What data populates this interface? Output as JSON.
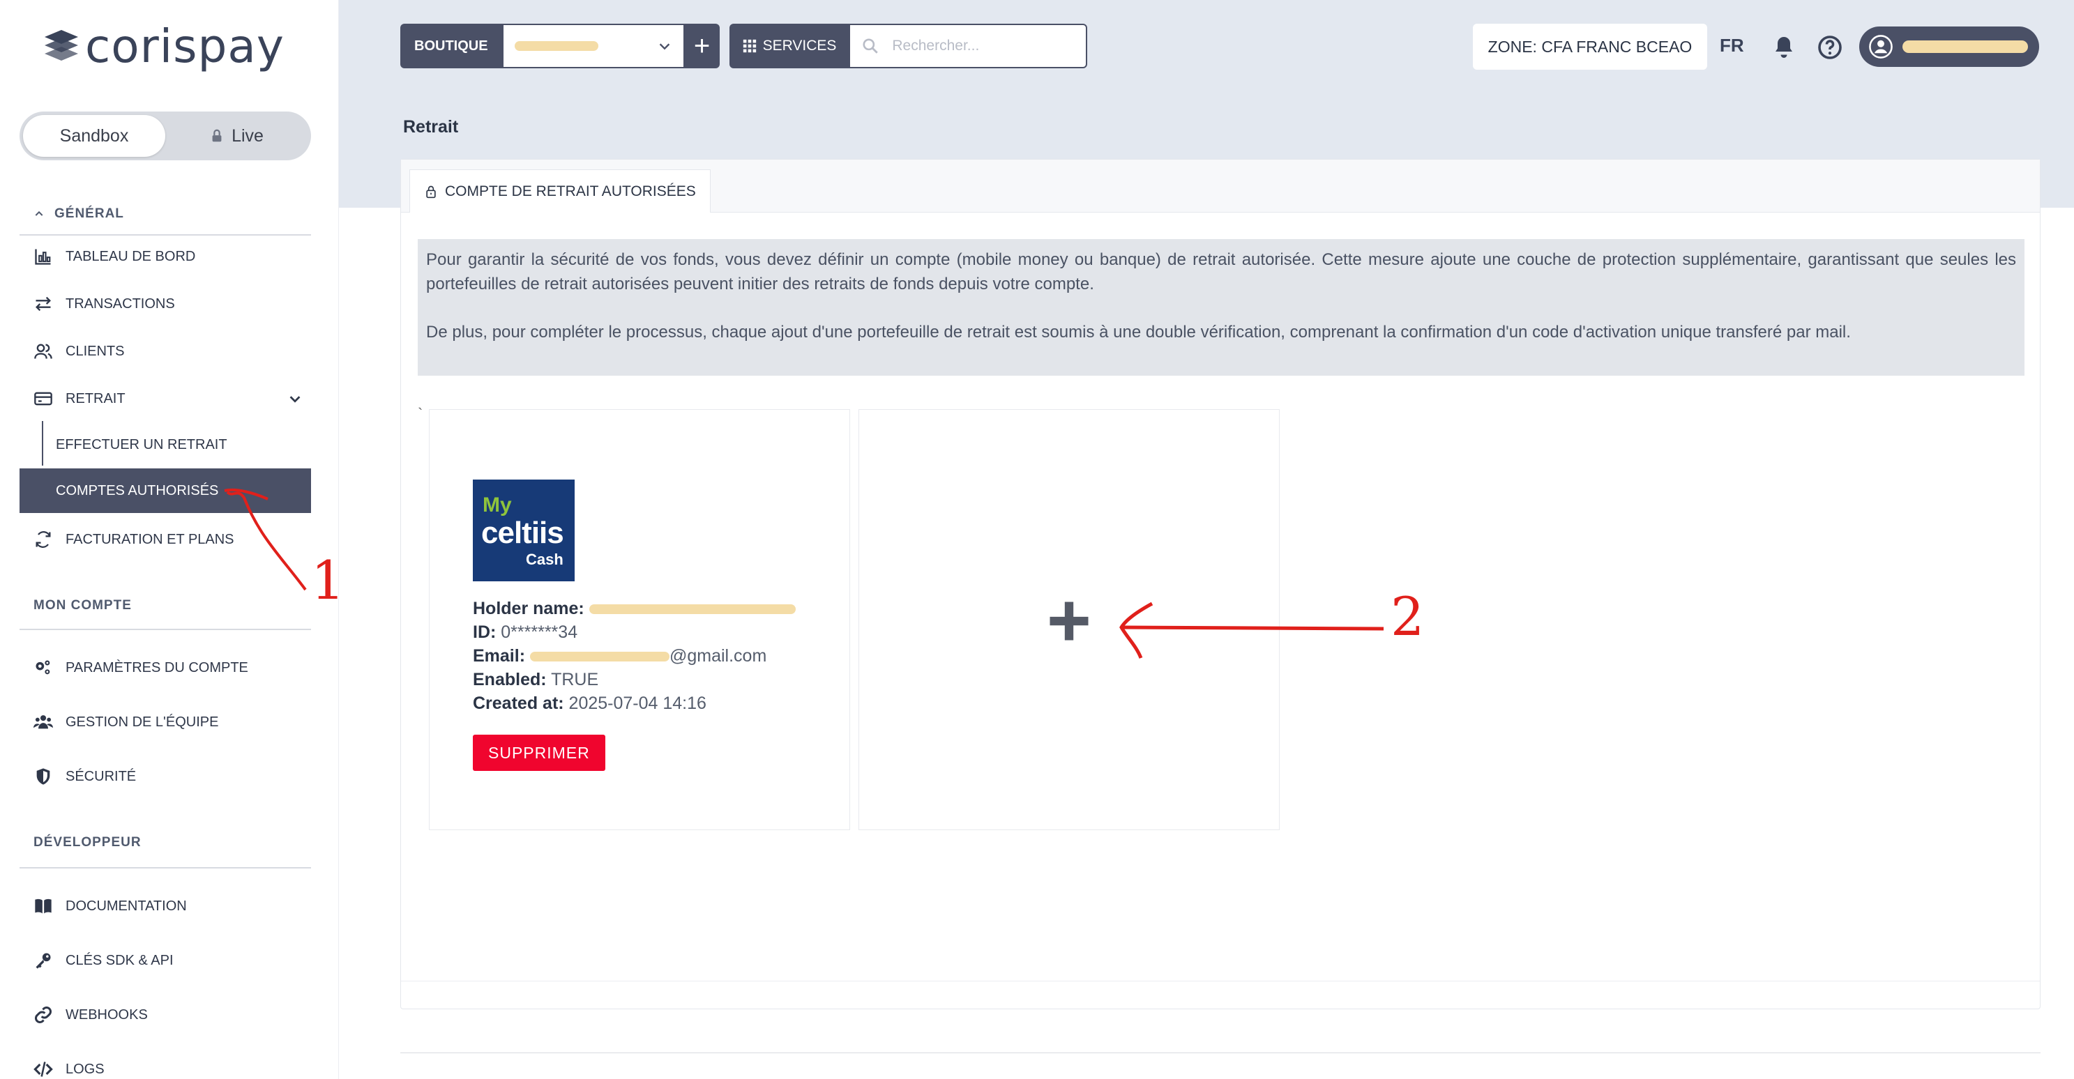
{
  "brand": {
    "name": "corispay"
  },
  "environment": {
    "sandbox_label": "Sandbox",
    "live_label": "Live",
    "active": "Sandbox"
  },
  "sidebar": {
    "general_title": "GÉNÉRAL",
    "general_items": [
      {
        "label": "TABLEAU DE BORD",
        "icon": "chart-bar-icon"
      },
      {
        "label": "TRANSACTIONS",
        "icon": "transfer-arrows-icon"
      },
      {
        "label": "CLIENTS",
        "icon": "users-icon"
      },
      {
        "label": "RETRAIT",
        "icon": "credit-card-icon"
      }
    ],
    "retrait_sub": [
      {
        "label": "EFFECTUER UN RETRAIT"
      },
      {
        "label": "COMPTES AUTHORISÉS",
        "active": true
      }
    ],
    "billing_item": {
      "label": "FACTURATION ET PLANS",
      "icon": "sync-icon"
    },
    "account_title": "MON COMPTE",
    "account_items": [
      {
        "label": "PARAMÈTRES DU COMPTE",
        "icon": "gears-icon"
      },
      {
        "label": "GESTION DE L'ÉQUIPE",
        "icon": "team-icon"
      },
      {
        "label": "SÉCURITÉ",
        "icon": "shield-icon"
      }
    ],
    "developer_title": "DÉVELOPPEUR",
    "developer_items": [
      {
        "label": "DOCUMENTATION",
        "icon": "book-icon"
      },
      {
        "label": "CLÉS SDK & API",
        "icon": "key-icon"
      },
      {
        "label": "WEBHOOKS",
        "icon": "link-icon"
      },
      {
        "label": "LOGS",
        "icon": "code-icon"
      }
    ]
  },
  "topbar": {
    "boutique_label": "BOUTIQUE",
    "add_symbol": "+",
    "services_label": "SERVICES",
    "search_placeholder": "Rechercher...",
    "zone_text": "ZONE:  CFA FRANC BCEAO",
    "language": "FR"
  },
  "page": {
    "title": "Retrait",
    "tab_label": "COMPTE DE RETRAIT AUTORISÉES",
    "notice_p1": "Pour garantir la sécurité de vos fonds, vous devez définir un compte (mobile money ou banque) de retrait autorisée. Cette mesure ajoute une couche de protection supplémentaire, garantissant que seules les portefeuilles de retrait autorisées peuvent initier des retraits de fonds depuis votre compte.",
    "notice_p2": "De plus, pour compléter le processus, chaque ajout d'une portefeuille de retrait est soumis à une double vérification, comprenant la confirmation d'un code d'activation unique transferé par mail.",
    "stray_char": "`"
  },
  "account": {
    "logo_line1": "My",
    "logo_line2": "celtiis",
    "logo_line3": "Cash",
    "holder_label": "Holder name:",
    "id_label": "ID:",
    "id_value": "0*******34",
    "email_label": "Email:",
    "email_suffix": "@gmail.com",
    "enabled_label": "Enabled:",
    "enabled_value": "TRUE",
    "created_label": "Created at:",
    "created_value": "2025-07-04 14:16",
    "delete_label": "SUPPRIMER"
  },
  "annotations": {
    "num1": "1",
    "num2": "2",
    "color": "#e0201b"
  },
  "colors": {
    "primary": "#4a5066",
    "danger": "#f0052e",
    "band": "#e3e8f0",
    "notice_bg": "#e2e5ea"
  }
}
